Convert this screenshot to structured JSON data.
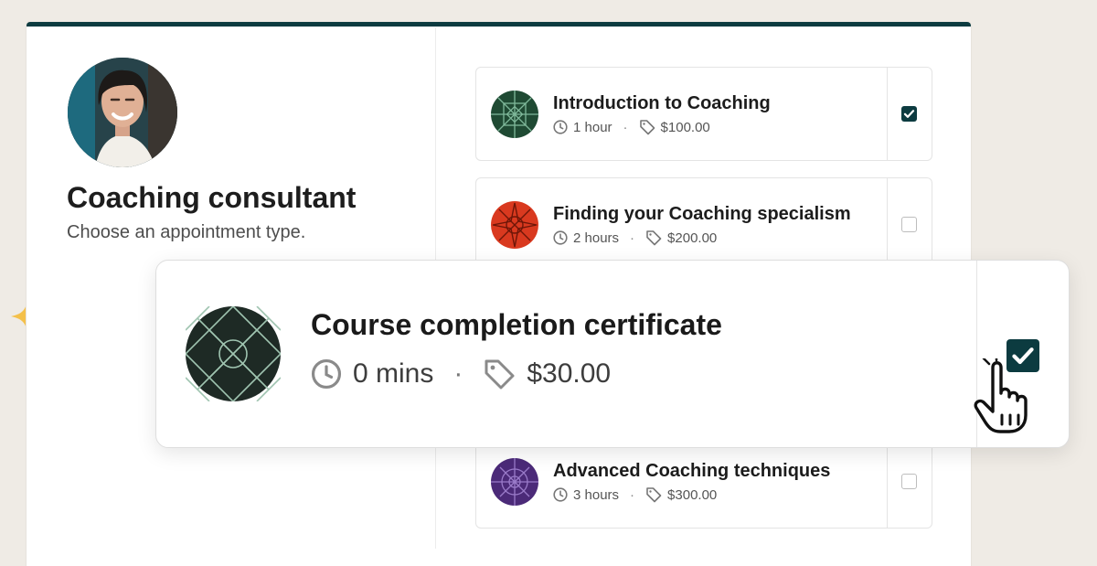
{
  "consultant": {
    "title": "Coaching consultant",
    "subtitle": "Choose an appointment type."
  },
  "services": [
    {
      "name": "Introduction to Coaching",
      "duration": "1 hour",
      "price": "$100.00",
      "checked": true,
      "icon_color": "#1f4a33"
    },
    {
      "name": "Finding your Coaching specialism",
      "duration": "2 hours",
      "price": "$200.00",
      "checked": false,
      "icon_color": "#d9391f"
    },
    {
      "name": "Advanced Coaching techniques",
      "duration": "3 hours",
      "price": "$300.00",
      "checked": false,
      "icon_color": "#4b2a78"
    }
  ],
  "featured": {
    "name": "Course completion certificate",
    "duration": "0 mins",
    "price": "$30.00",
    "checked": true,
    "icon_color": "#1e2a25"
  },
  "colors": {
    "accent": "#0c3b40",
    "background": "#efebe5",
    "sparkle": "#f4c04a"
  },
  "icons": [
    "clock-icon",
    "price-tag-icon",
    "checkbox-icon",
    "pointer-hand-icon",
    "sparkle-icon"
  ]
}
